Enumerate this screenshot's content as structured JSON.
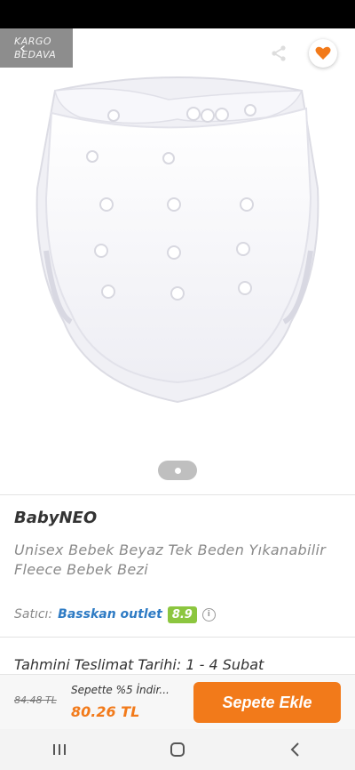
{
  "gallery": {
    "cargo_badge": {
      "line1": "KARGO",
      "line2": "BEDAVA"
    },
    "icons": {
      "back": "back-arrow-icon",
      "share": "share-icon",
      "favorite": "heart-icon"
    },
    "favorite_color": "#f27a1a"
  },
  "product": {
    "brand": "BabyNEO",
    "title": "Unisex Bebek Beyaz Tek Beden Yıkanabilir Fleece Bebek Bezi"
  },
  "seller": {
    "label": "Satıcı:",
    "name": "Basskan outlet",
    "score": "8.9",
    "score_color": "#8cc63f"
  },
  "delivery": {
    "text": "Tahmini Teslimat Tarihi: 1 - 4 Subat"
  },
  "purchase": {
    "old_price": "84.48 TL",
    "promo": "Sepette %5 İndir...",
    "price": "80.26 TL",
    "add_to_cart": "Sepete Ekle",
    "accent": "#f27a1a"
  },
  "nav": {
    "icons": [
      "recent-apps-icon",
      "home-icon",
      "back-icon"
    ]
  }
}
